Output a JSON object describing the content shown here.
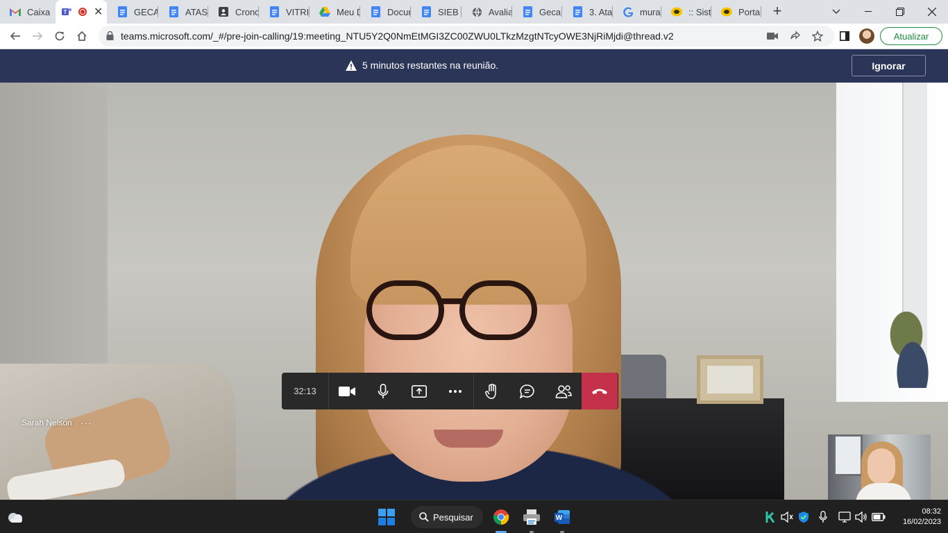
{
  "browser": {
    "tabs": [
      {
        "label": "Caixa",
        "icon": "gmail-icon"
      },
      {
        "label": "",
        "icon": "teams-icon",
        "active": true,
        "recording": true
      },
      {
        "label": "GECA",
        "icon": "google-docs-icon"
      },
      {
        "label": "ATAS",
        "icon": "google-docs-icon"
      },
      {
        "label": "Crono",
        "icon": "contact-card-icon"
      },
      {
        "label": "VITRIN",
        "icon": "google-docs-icon"
      },
      {
        "label": "Meu D",
        "icon": "google-drive-icon"
      },
      {
        "label": "Docur",
        "icon": "google-docs-icon"
      },
      {
        "label": "SIEB -",
        "icon": "google-docs-icon"
      },
      {
        "label": "Avalia",
        "icon": "globe-icon"
      },
      {
        "label": "Geca",
        "icon": "google-docs-icon"
      },
      {
        "label": "3. Ata",
        "icon": "google-docs-icon"
      },
      {
        "label": "mural",
        "icon": "google-icon"
      },
      {
        "label": ":: Siste",
        "icon": "yellow-logo-icon"
      },
      {
        "label": "Portal",
        "icon": "yellow-logo-icon"
      }
    ],
    "new_tab": "+",
    "tab_close": "✕",
    "url": "teams.microsoft.com/_#/pre-join-calling/19:meeting_NTU5Y2Q0NmEtMGI3ZC00ZWU0LTkzMzgtNTcyOWE3NjRiMjdi@thread.v2",
    "update_button": "Atualizar"
  },
  "teams": {
    "banner_message": "5 minutos restantes na reunião.",
    "ignore_button": "Ignorar",
    "participant_name": "Sarah Nelson",
    "participant_more": "···",
    "call_timer": "32:13",
    "hangup_color": "#c4314b"
  },
  "taskbar": {
    "search_label": "Pesquisar",
    "time": "08:32",
    "date": "16/02/2023"
  }
}
